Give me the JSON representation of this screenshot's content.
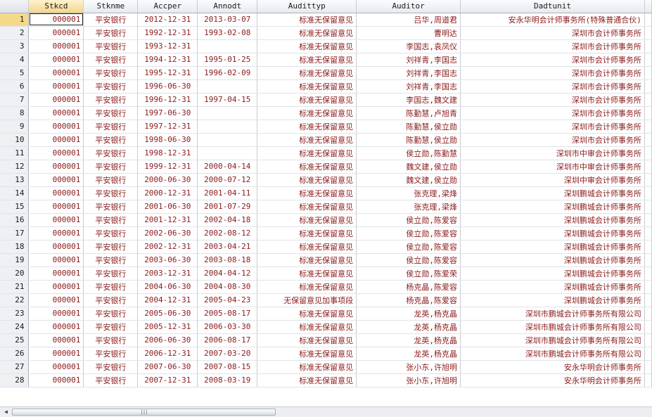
{
  "columns": [
    "Stkcd",
    "Stknme",
    "Accper",
    "Annodt",
    "Audittyp",
    "Auditor",
    "Dadtunit"
  ],
  "rows": [
    [
      "1",
      "000001",
      "平安银行",
      "2012-12-31",
      "2013-03-07",
      "标准无保留意见",
      "吕华,周道君",
      "安永华明会计师事务所(特殊普通合伙)"
    ],
    [
      "2",
      "000001",
      "平安银行",
      "1992-12-31",
      "1993-02-08",
      "标准无保留意见",
      "曹明达",
      "深圳市会计师事务所"
    ],
    [
      "3",
      "000001",
      "平安银行",
      "1993-12-31",
      "",
      "标准无保留意见",
      "李国志,袁凤仪",
      "深圳市会计师事务所"
    ],
    [
      "4",
      "000001",
      "平安银行",
      "1994-12-31",
      "1995-01-25",
      "标准无保留意见",
      "刘祥青,李国志",
      "深圳市会计师事务所"
    ],
    [
      "5",
      "000001",
      "平安银行",
      "1995-12-31",
      "1996-02-09",
      "标准无保留意见",
      "刘祥青,李国志",
      "深圳市会计师事务所"
    ],
    [
      "6",
      "000001",
      "平安银行",
      "1996-06-30",
      "",
      "标准无保留意见",
      "刘祥青,李国志",
      "深圳市会计师事务所"
    ],
    [
      "7",
      "000001",
      "平安银行",
      "1996-12-31",
      "1997-04-15",
      "标准无保留意见",
      "李国志,魏文建",
      "深圳市会计师事务所"
    ],
    [
      "8",
      "000001",
      "平安银行",
      "1997-06-30",
      "",
      "标准无保留意见",
      "陈勤慧,卢旭青",
      "深圳市会计师事务所"
    ],
    [
      "9",
      "000001",
      "平安银行",
      "1997-12-31",
      "",
      "标准无保留意见",
      "陈勤慧,侯立勋",
      "深圳市会计师事务所"
    ],
    [
      "10",
      "000001",
      "平安银行",
      "1998-06-30",
      "",
      "标准无保留意见",
      "陈勤慧,侯立勋",
      "深圳市会计师事务所"
    ],
    [
      "11",
      "000001",
      "平安银行",
      "1998-12-31",
      "",
      "标准无保留意见",
      "侯立勋,陈勤慧",
      "深圳市中审会计师事务所"
    ],
    [
      "12",
      "000001",
      "平安银行",
      "1999-12-31",
      "2000-04-14",
      "标准无保留意见",
      "魏文建,侯立勋",
      "深圳市中审会计师事务所"
    ],
    [
      "13",
      "000001",
      "平安银行",
      "2000-06-30",
      "2000-07-12",
      "标准无保留意见",
      "魏文建,侯立勋",
      "深圳中审会计师事务所"
    ],
    [
      "14",
      "000001",
      "平安银行",
      "2000-12-31",
      "2001-04-11",
      "标准无保留意见",
      "张克理,梁烽",
      "深圳鹏城会计师事务所"
    ],
    [
      "15",
      "000001",
      "平安银行",
      "2001-06-30",
      "2001-07-29",
      "标准无保留意见",
      "张克理,梁烽",
      "深圳鹏城会计师事务所"
    ],
    [
      "16",
      "000001",
      "平安银行",
      "2001-12-31",
      "2002-04-18",
      "标准无保留意见",
      "侯立勋,陈爱容",
      "深圳鹏城会计师事务所"
    ],
    [
      "17",
      "000001",
      "平安银行",
      "2002-06-30",
      "2002-08-12",
      "标准无保留意见",
      "侯立勋,陈爱容",
      "深圳鹏城会计师事务所"
    ],
    [
      "18",
      "000001",
      "平安银行",
      "2002-12-31",
      "2003-04-21",
      "标准无保留意见",
      "侯立勋,陈爱容",
      "深圳鹏城会计师事务所"
    ],
    [
      "19",
      "000001",
      "平安银行",
      "2003-06-30",
      "2003-08-18",
      "标准无保留意见",
      "侯立勋,陈爱容",
      "深圳鹏城会计师事务所"
    ],
    [
      "20",
      "000001",
      "平安银行",
      "2003-12-31",
      "2004-04-12",
      "标准无保留意见",
      "侯立勋,陈爱荣",
      "深圳鹏城会计师事务所"
    ],
    [
      "21",
      "000001",
      "平安银行",
      "2004-06-30",
      "2004-08-30",
      "标准无保留意见",
      "杨克晶,陈爱容",
      "深圳鹏城会计师事务所"
    ],
    [
      "22",
      "000001",
      "平安银行",
      "2004-12-31",
      "2005-04-23",
      "无保留意见加事项段",
      "杨克晶,陈爱容",
      "深圳鹏城会计师事务所"
    ],
    [
      "23",
      "000001",
      "平安银行",
      "2005-06-30",
      "2005-08-17",
      "标准无保留意见",
      "龙英,杨克晶",
      "深圳市鹏城会计师事务所有限公司"
    ],
    [
      "24",
      "000001",
      "平安银行",
      "2005-12-31",
      "2006-03-30",
      "标准无保留意见",
      "龙英,杨克晶",
      "深圳市鹏城会计师事务所有限公司"
    ],
    [
      "25",
      "000001",
      "平安银行",
      "2006-06-30",
      "2006-08-17",
      "标准无保留意见",
      "龙英,杨克晶",
      "深圳市鹏城会计师事务所有限公司"
    ],
    [
      "26",
      "000001",
      "平安银行",
      "2006-12-31",
      "2007-03-20",
      "标准无保留意见",
      "龙英,杨克晶",
      "深圳市鹏城会计师事务所有限公司"
    ],
    [
      "27",
      "000001",
      "平安银行",
      "2007-06-30",
      "2007-08-15",
      "标准无保留意见",
      "张小东,许旭明",
      "安永华明会计师事务所"
    ],
    [
      "28",
      "000001",
      "平安银行",
      "2007-12-31",
      "2008-03-19",
      "标准无保留意见",
      "张小东,许旭明",
      "安永华明会计师事务所"
    ]
  ],
  "selected": {
    "row": 1,
    "column": "Stkcd"
  },
  "colors": {
    "text": "#8b1a1a",
    "active_row_header": "#f5d98b",
    "header_bg": "#e6e9ef"
  }
}
